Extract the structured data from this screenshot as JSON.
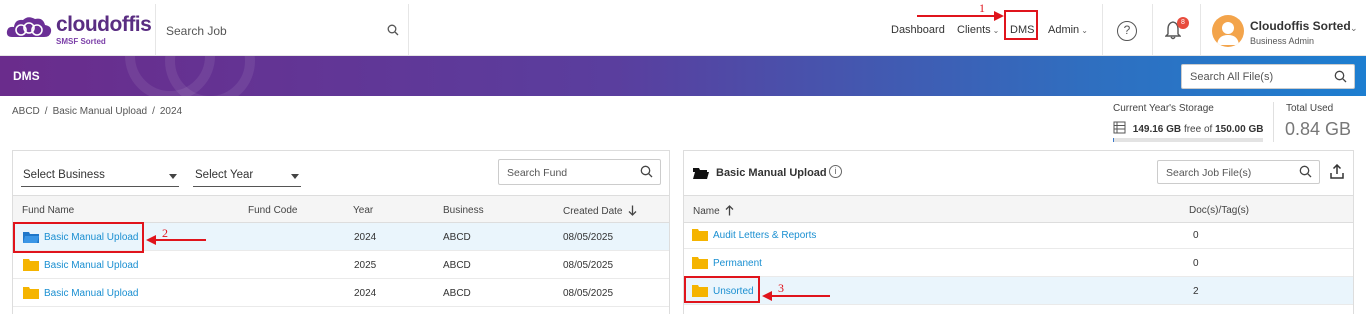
{
  "brand": {
    "name": "cloudoffis",
    "tagline": "SMSF Sorted",
    "color": "#5a2d82"
  },
  "header": {
    "search_placeholder": "Search Job",
    "nav": {
      "dashboard": "Dashboard",
      "clients": "Clients",
      "dms": "DMS",
      "admin": "Admin"
    },
    "notifications_count": "8",
    "user": {
      "name": "Cloudoffis Sorted",
      "role": "Business Admin"
    }
  },
  "banner": {
    "title": "DMS",
    "search_placeholder": "Search All File(s)"
  },
  "breadcrumb": [
    "ABCD",
    "Basic Manual Upload",
    "2024"
  ],
  "storage": {
    "title": "Current Year's Storage",
    "used_value": "149.16 GB",
    "free_text": "free of",
    "total_value": "150.00 GB",
    "used_fraction": 0.006,
    "total_used_label": "Total Used",
    "total_used_value": "0.84 GB"
  },
  "fund_panel": {
    "business_select": "Select Business",
    "year_select": "Select Year",
    "search_placeholder": "Search Fund",
    "columns": {
      "name": "Fund Name",
      "code": "Fund Code",
      "year": "Year",
      "business": "Business",
      "created": "Created Date"
    },
    "rows": [
      {
        "name": "Basic Manual Upload",
        "code": "",
        "year": "2024",
        "business": "ABCD",
        "created": "08/05/2025"
      },
      {
        "name": "Basic Manual Upload",
        "code": "",
        "year": "2025",
        "business": "ABCD",
        "created": "08/05/2025"
      },
      {
        "name": "Basic Manual Upload",
        "code": "",
        "year": "2024",
        "business": "ABCD",
        "created": "08/05/2025"
      }
    ]
  },
  "files_panel": {
    "title": "Basic Manual Upload",
    "search_placeholder": "Search Job File(s)",
    "columns": {
      "name": "Name",
      "docs": "Doc(s)/Tag(s)"
    },
    "rows": [
      {
        "name": "Audit Letters & Reports",
        "docs": "0"
      },
      {
        "name": "Permanent",
        "docs": "0"
      },
      {
        "name": "Unsorted",
        "docs": "2"
      }
    ]
  },
  "annotations": {
    "one": "1",
    "two": "2",
    "three": "3",
    "color": "#e0141c"
  }
}
